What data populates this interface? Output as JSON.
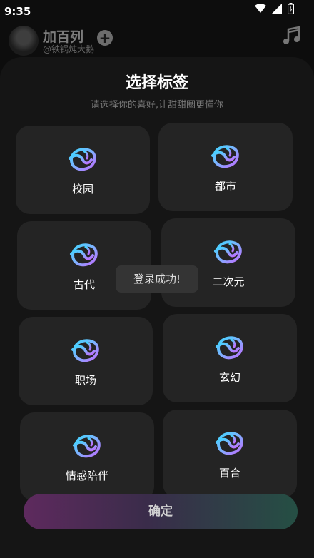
{
  "status": {
    "time": "9:35"
  },
  "header": {
    "name": "加百列",
    "handle": "@铁锅炖大鹅"
  },
  "sheet": {
    "title": "选择标签",
    "subtitle": "请选择你的喜好,让甜甜圈更懂你"
  },
  "tags": [
    {
      "label": "校园",
      "icon": "donut-logo-icon"
    },
    {
      "label": "都市",
      "icon": "donut-logo-icon"
    },
    {
      "label": "古代",
      "icon": "donut-logo-icon"
    },
    {
      "label": "二次元",
      "icon": "donut-logo-icon"
    },
    {
      "label": "职场",
      "icon": "donut-logo-icon"
    },
    {
      "label": "玄幻",
      "icon": "donut-logo-icon"
    },
    {
      "label": "情感陪伴",
      "icon": "donut-logo-icon"
    },
    {
      "label": "百合",
      "icon": "donut-logo-icon"
    }
  ],
  "toast": "登录成功!",
  "confirm_label": "确定",
  "colors": {
    "background": "#0d0d0d",
    "card": "#242424",
    "gradient_start": "#5e2a5e",
    "gradient_end": "#254f44"
  }
}
